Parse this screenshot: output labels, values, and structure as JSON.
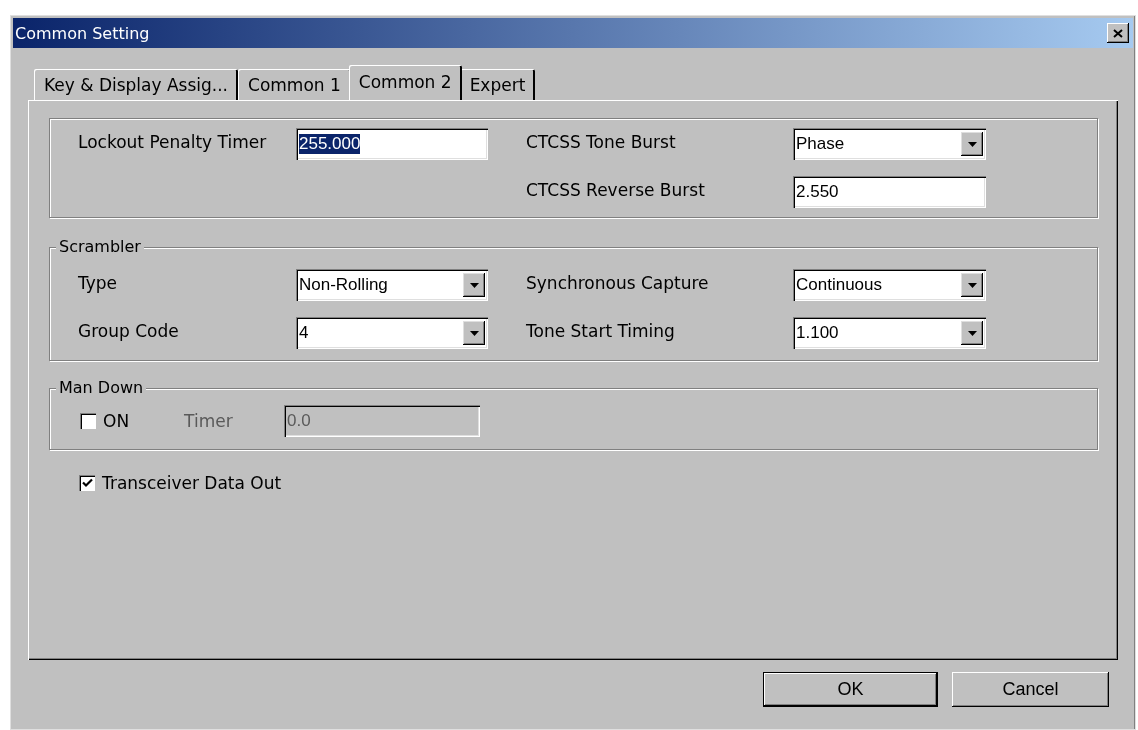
{
  "window": {
    "title": "Common Setting"
  },
  "tabs": [
    {
      "label": "Key & Display Assig...",
      "selected": false
    },
    {
      "label": "Common 1",
      "selected": false
    },
    {
      "label": "Common 2",
      "selected": true
    },
    {
      "label": "Expert",
      "selected": false
    }
  ],
  "general": {
    "left": [
      {
        "kind": "text",
        "label": "Lockout Penalty Timer",
        "value": "255.000",
        "highlighted": true
      }
    ],
    "right": [
      {
        "kind": "dropdown",
        "label": "CTCSS Tone Burst",
        "value": "Phase"
      },
      {
        "kind": "text",
        "label": "CTCSS Reverse Burst",
        "value": "2.550",
        "highlighted": false
      }
    ]
  },
  "scrambler": {
    "title": "Scrambler",
    "left": [
      {
        "kind": "dropdown",
        "label": "Type",
        "value": "Non-Rolling"
      },
      {
        "kind": "dropdown",
        "label": "Group Code",
        "value": "4"
      }
    ],
    "right": [
      {
        "kind": "dropdown",
        "label": "Synchronous Capture",
        "value": "Continuous"
      },
      {
        "kind": "dropdown",
        "label": "Tone Start Timing",
        "value": "1.100"
      }
    ]
  },
  "man_down": {
    "title": "Man Down",
    "on": {
      "label": "ON",
      "checked": false
    },
    "timer": {
      "label": "Timer",
      "value": "0.0",
      "disabled": true
    }
  },
  "transceiver_data_out": {
    "label": "Transceiver Data Out",
    "checked": true
  },
  "buttons": [
    {
      "label": "OK",
      "default": true
    },
    {
      "label": "Cancel",
      "default": false
    }
  ]
}
